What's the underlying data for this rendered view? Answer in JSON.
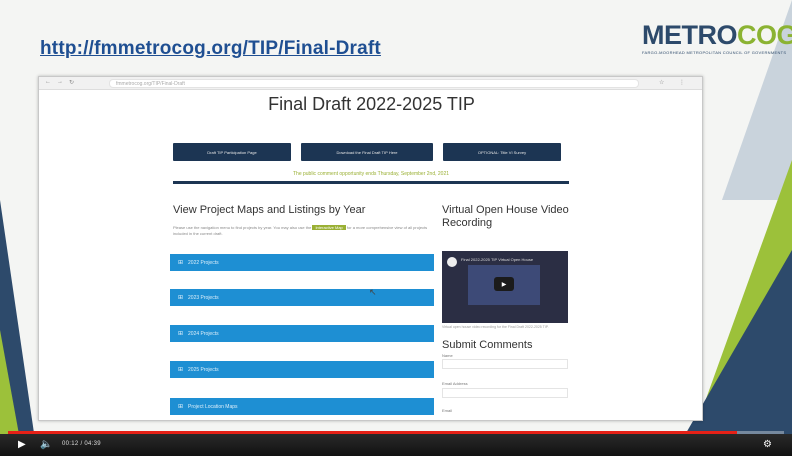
{
  "slide": {
    "url_heading": "http://fmmetrocog.org/TIP/Final-Draft",
    "logo": {
      "metro": "METRO",
      "cog": "COG",
      "tagline": "FARGO-MOORHEAD METROPOLITAN COUNCIL OF GOVERNMENTS"
    }
  },
  "browser": {
    "nav_icons": [
      "back-arrow-icon",
      "forward-arrow-icon",
      "reload-icon"
    ],
    "address": "fmmetrocog.org/TIP/Final-Draft"
  },
  "page": {
    "title": "Final Draft 2022-2025 TIP",
    "buttons": [
      {
        "label": "Draft TIP Participation Page"
      },
      {
        "label": "Download the Final Draft TIP Here"
      },
      {
        "label": "OPTIONAL: Title VI Survey"
      }
    ],
    "notice": "The public comment opportunity ends Thursday, September 2nd, 2021",
    "section_title": "View Project Maps and Listings by Year",
    "description_before": "Please use the navigation menu to find projects by year. You may also use the",
    "description_highlight": "Interactive Map",
    "description_after": "for a more comprehensive view of all projects included in the current draft.",
    "accordion": [
      {
        "label": "2022 Projects"
      },
      {
        "label": "2023 Projects"
      },
      {
        "label": "2024 Projects"
      },
      {
        "label": "2025 Projects"
      },
      {
        "label": "Project Location Maps"
      }
    ],
    "sidebar": {
      "video_title": "Virtual Open House Video Recording",
      "video_caption": "Final 2022-2025 TIP Virtual Open House",
      "video_note": "Virtual open house video recording for the Final Draft 2022-2025 TIP.",
      "comments_title": "Submit Comments",
      "fields": [
        {
          "label": "Name"
        },
        {
          "label": "Email Address"
        },
        {
          "label": "Email"
        }
      ]
    }
  },
  "player": {
    "time": "00:12 / 04:39",
    "progress": 0.94,
    "colors": {
      "progress": "#e62117"
    }
  }
}
